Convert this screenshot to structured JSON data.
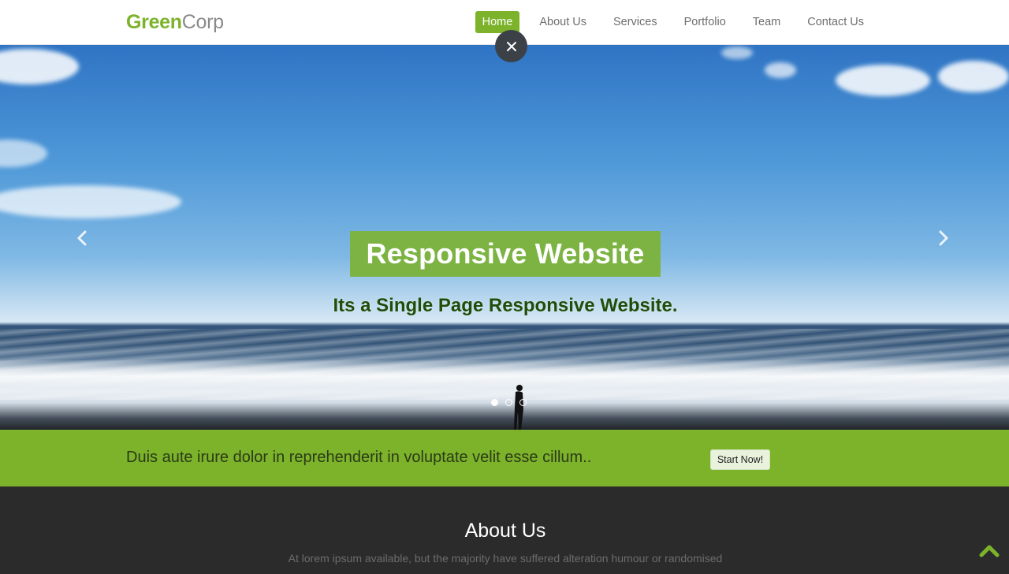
{
  "brand": {
    "part1": "Green",
    "part2": "Corp"
  },
  "nav": {
    "items": [
      {
        "label": "Home",
        "active": true
      },
      {
        "label": "About Us"
      },
      {
        "label": "Services"
      },
      {
        "label": "Portfolio"
      },
      {
        "label": "Team"
      },
      {
        "label": "Contact Us"
      }
    ],
    "close_icon": "×"
  },
  "hero": {
    "title": "Responsive Website",
    "subtitle": "Its a Single Page Responsive Website.",
    "prev_icon": "chevron-left-icon",
    "next_icon": "chevron-right-icon"
  },
  "cta": {
    "text": "Duis aute irure dolor in reprehenderit in voluptate velit esse cillum..",
    "button": "Start Now!"
  },
  "about": {
    "title": "About Us",
    "subtitle": "At lorem ipsum available, but the majority have suffered alteration humour or randomised"
  },
  "colors": {
    "accent": "#7cb32b",
    "dark": "#2b2b2b",
    "close_bg": "#3c4148"
  }
}
